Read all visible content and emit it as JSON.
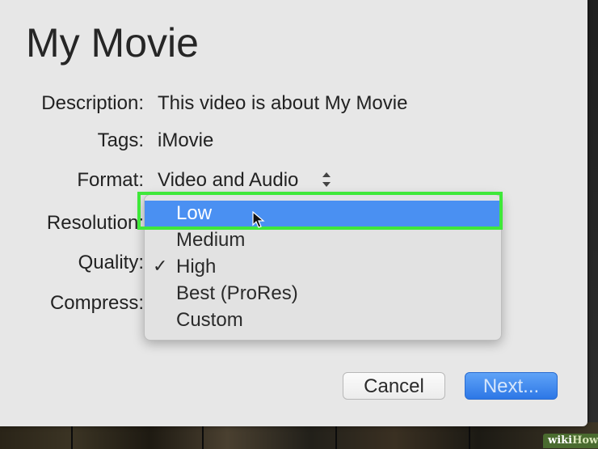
{
  "dialog": {
    "title": "My Movie",
    "fields": {
      "description": {
        "label": "Description:",
        "value": "This video is about My Movie"
      },
      "tags": {
        "label": "Tags:",
        "value": "iMovie"
      },
      "format": {
        "label": "Format:",
        "value": "Video and Audio"
      },
      "resolution": {
        "label": "Resolution:"
      },
      "quality": {
        "label": "Quality:"
      },
      "compress": {
        "label": "Compress:"
      }
    }
  },
  "quality_menu": {
    "items": [
      {
        "label": "Low",
        "highlighted": true,
        "checked": false
      },
      {
        "label": "Medium",
        "highlighted": false,
        "checked": false
      },
      {
        "label": "High",
        "highlighted": false,
        "checked": true
      },
      {
        "label": "Best (ProRes)",
        "highlighted": false,
        "checked": false
      },
      {
        "label": "Custom",
        "highlighted": false,
        "checked": false
      }
    ],
    "checkmark": "✓"
  },
  "buttons": {
    "cancel": "Cancel",
    "next": "Next..."
  },
  "watermark": {
    "wiki": "wiki",
    "how": "How"
  },
  "colors": {
    "dialog_bg": "#e7e7e7",
    "menu_selection": "#4a90f2",
    "highlight_outline": "#3fe83a",
    "primary_button": "#2d77e6"
  },
  "icons": {
    "stepper": "up-down-chevron-icon",
    "cursor": "mouse-pointer-icon",
    "check": "checkmark-icon"
  }
}
